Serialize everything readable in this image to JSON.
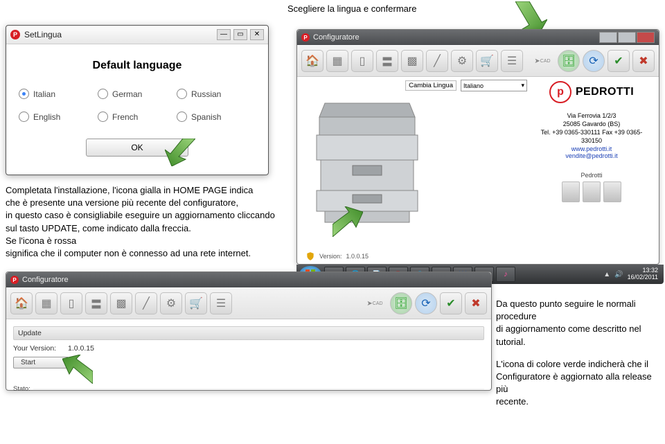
{
  "instructions": {
    "top": "Scegliere la lingua e confermare",
    "paragraph_lines": [
      "Completata l'installazione, l'icona gialla in HOME PAGE indica",
      "che è presente una versione più recente del configuratore,",
      "in questo caso è consigliabile eseguire un aggiornamento cliccando",
      "sul tasto UPDATE, come indicato dalla freccia.",
      "Se l'icona è rossa",
      "significa che il computer non è connesso ad una rete internet."
    ],
    "right_block": [
      "Da questo punto seguire le normali procedure",
      "di aggiornamento come descritto nel tutorial.",
      "",
      "L'icona di colore verde indicherà che il",
      "Configuratore è aggiornato alla release più",
      "recente."
    ]
  },
  "setlingua": {
    "window_title": "SetLingua",
    "heading": "Default language",
    "languages": {
      "r1c1": "Italian",
      "r1c2": "German",
      "r1c3": "Russian",
      "r2c1": "English",
      "r2c2": "French",
      "r2c3": "Spanish"
    },
    "selected": "Italian",
    "ok_label": "OK"
  },
  "cfg1": {
    "window_title": "Configuratore",
    "cambia_label": "Cambia Lingua",
    "cambia_value": "Italiano",
    "brand": "PEDROTTI",
    "address": [
      "Via Ferrovia 1/2/3",
      "25085 Gavardo (BS)",
      "Tel. +39 0365-330111 Fax +39 0365-330150"
    ],
    "links": {
      "site": "www.pedrotti.it",
      "email": "vendite@pedrotti.it"
    },
    "sublabel": "Pedrotti",
    "version_label": "Version:",
    "version_value": "1.0.0.15"
  },
  "taskbar": {
    "time": "13:32",
    "date": "16/02/2011"
  },
  "cfg2": {
    "window_title": "Configuratore",
    "update_head": "Update",
    "your_version_label": "Your Version:",
    "your_version_value": "1.0.0.15",
    "start_label": "Start",
    "stato_label": "Stato:"
  }
}
